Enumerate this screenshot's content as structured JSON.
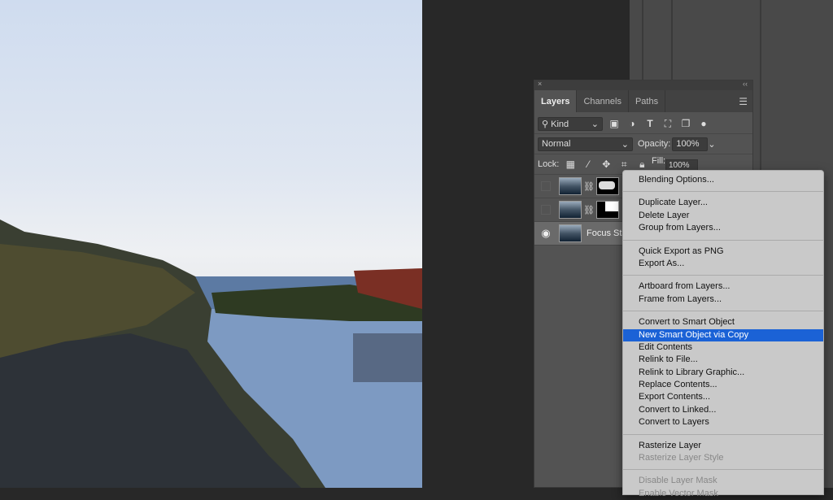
{
  "panel": {
    "tabs": [
      {
        "label": "Layers",
        "active": true
      },
      {
        "label": "Channels"
      },
      {
        "label": "Paths"
      }
    ],
    "close_glyph": "×",
    "collapse_glyph": "‹‹",
    "filter": {
      "value": "Kind"
    },
    "blend_mode": "Normal",
    "opacity_label": "Opacity:",
    "opacity": "100%",
    "lock_label": "Lock:",
    "fill_label": "Fill:",
    "fill": "100%",
    "layers": [
      {
        "name": "",
        "visible": false
      },
      {
        "name": "",
        "visible": false
      },
      {
        "name": "Focus Sta",
        "visible": true,
        "selected": true
      }
    ]
  },
  "context_menu": {
    "groups": [
      [
        {
          "label": "Blending Options..."
        }
      ],
      [
        {
          "label": "Duplicate Layer..."
        },
        {
          "label": "Delete Layer"
        },
        {
          "label": "Group from Layers..."
        }
      ],
      [
        {
          "label": "Quick Export as PNG"
        },
        {
          "label": "Export As..."
        }
      ],
      [
        {
          "label": "Artboard from Layers..."
        },
        {
          "label": "Frame from Layers..."
        }
      ],
      [
        {
          "label": "Convert to Smart Object"
        },
        {
          "label": "New Smart Object via Copy",
          "highlighted": true
        },
        {
          "label": "Edit Contents"
        },
        {
          "label": "Relink to File..."
        },
        {
          "label": "Relink to Library Graphic..."
        },
        {
          "label": "Replace Contents..."
        },
        {
          "label": "Export Contents..."
        },
        {
          "label": "Convert to Linked..."
        },
        {
          "label": "Convert to Layers"
        }
      ],
      [
        {
          "label": "Rasterize Layer"
        },
        {
          "label": "Rasterize Layer Style",
          "disabled": true
        }
      ],
      [
        {
          "label": "Disable Layer Mask",
          "disabled": true
        },
        {
          "label": "Enable Vector Mask",
          "disabled": true
        }
      ]
    ]
  },
  "colors": {
    "highlight": "#1b62d6",
    "menu_bg": "#c9c9c9",
    "panel_bg": "#535353"
  }
}
